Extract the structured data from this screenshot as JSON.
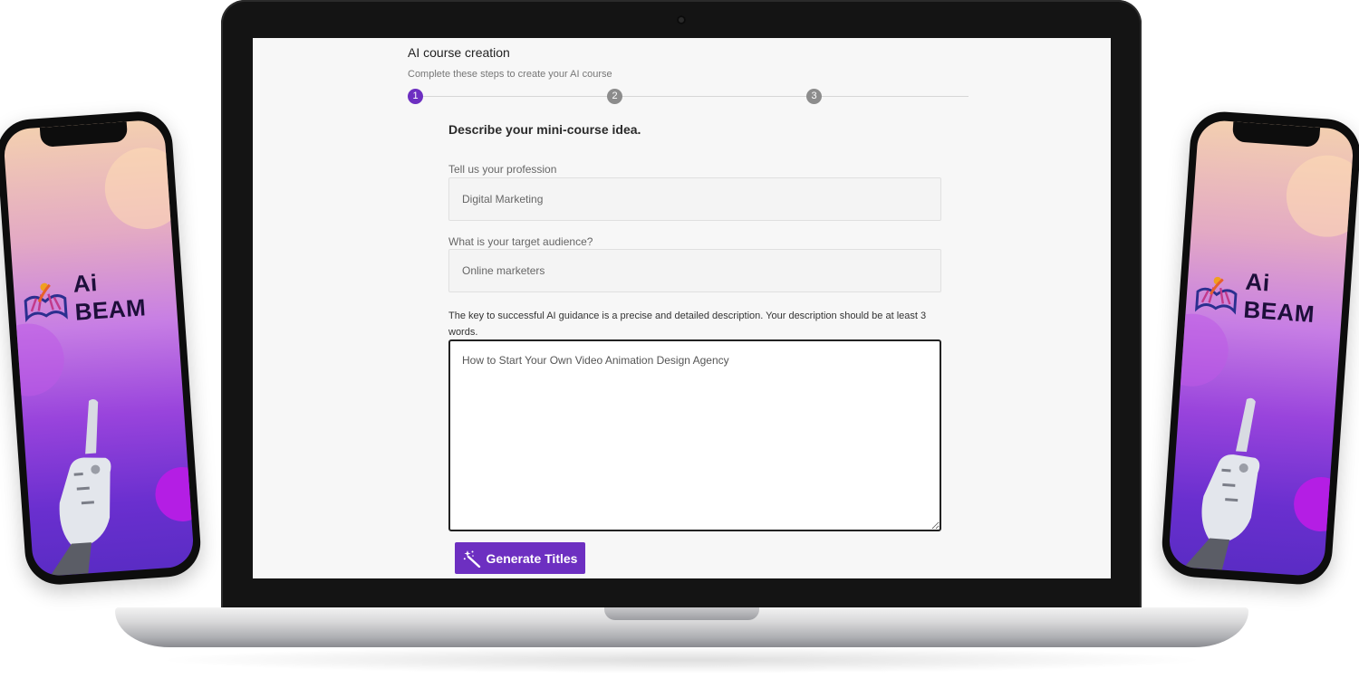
{
  "app": {
    "title": "AI course creation",
    "subtitle": "Complete these steps to create your AI course"
  },
  "steps": [
    {
      "label": "1",
      "state": "active"
    },
    {
      "label": "2",
      "state": "inactive"
    },
    {
      "label": "3",
      "state": "inactive"
    }
  ],
  "form": {
    "heading": "Describe your mini-course idea.",
    "profession": {
      "label": "Tell us your profession",
      "value": "Digital Marketing"
    },
    "audience": {
      "label": "What is your target audience?",
      "value": "Online marketers"
    },
    "description": {
      "hint": "The key to successful AI guidance is a precise and detailed description. Your description should be at least 3 words.",
      "value": "How to Start Your Own Video Animation Design Agency"
    },
    "generate_label": "Generate Titles"
  },
  "brand": {
    "name": "Ai BEAM"
  },
  "colors": {
    "accent": "#6d2fc1",
    "step_inactive": "#8c8c8c"
  },
  "icons": [
    "wand-icon",
    "brand-logo-icon",
    "robot-hand-image"
  ]
}
